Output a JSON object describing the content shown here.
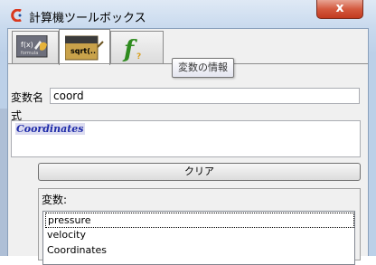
{
  "window": {
    "title": "計算機ツールボックス",
    "close_label": "x"
  },
  "tabs": [
    {
      "label": "f(x)",
      "sublabel": "formula",
      "icon": "formula-tab-icon"
    },
    {
      "label": "sqrt(..",
      "icon": "sqrt-tab-icon"
    },
    {
      "label": "f",
      "icon": "function-info-tab-icon"
    }
  ],
  "tooltip": "変数の情報",
  "form": {
    "varname_label": "変数名",
    "varname_value": "coord",
    "expr_label": "式",
    "expr_value": "Coordinates",
    "clear_label": "クリア",
    "vars_label": "変数:",
    "variables": [
      "pressure",
      "velocity",
      "Coordinates"
    ]
  },
  "colors": {
    "expr_text": "#1d2aa8",
    "close_button": "#d45a3f"
  }
}
